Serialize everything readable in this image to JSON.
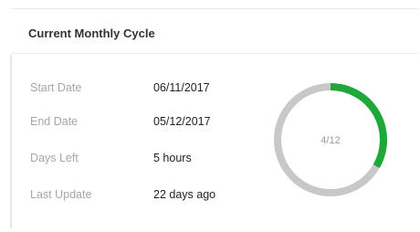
{
  "cycle": {
    "title": "Current Monthly Cycle",
    "rows": [
      {
        "label": "Start Date",
        "value": "06/11/2017"
      },
      {
        "label": "End Date",
        "value": "05/12/2017"
      },
      {
        "label": "Days Left",
        "value": "5 hours"
      },
      {
        "label": "Last Update",
        "value": "22 days ago"
      }
    ],
    "progress": {
      "text": "4/12",
      "completed": 4,
      "total": 12,
      "colors": {
        "progress": "#1ea83a",
        "track": "#c8c8c8"
      }
    }
  }
}
